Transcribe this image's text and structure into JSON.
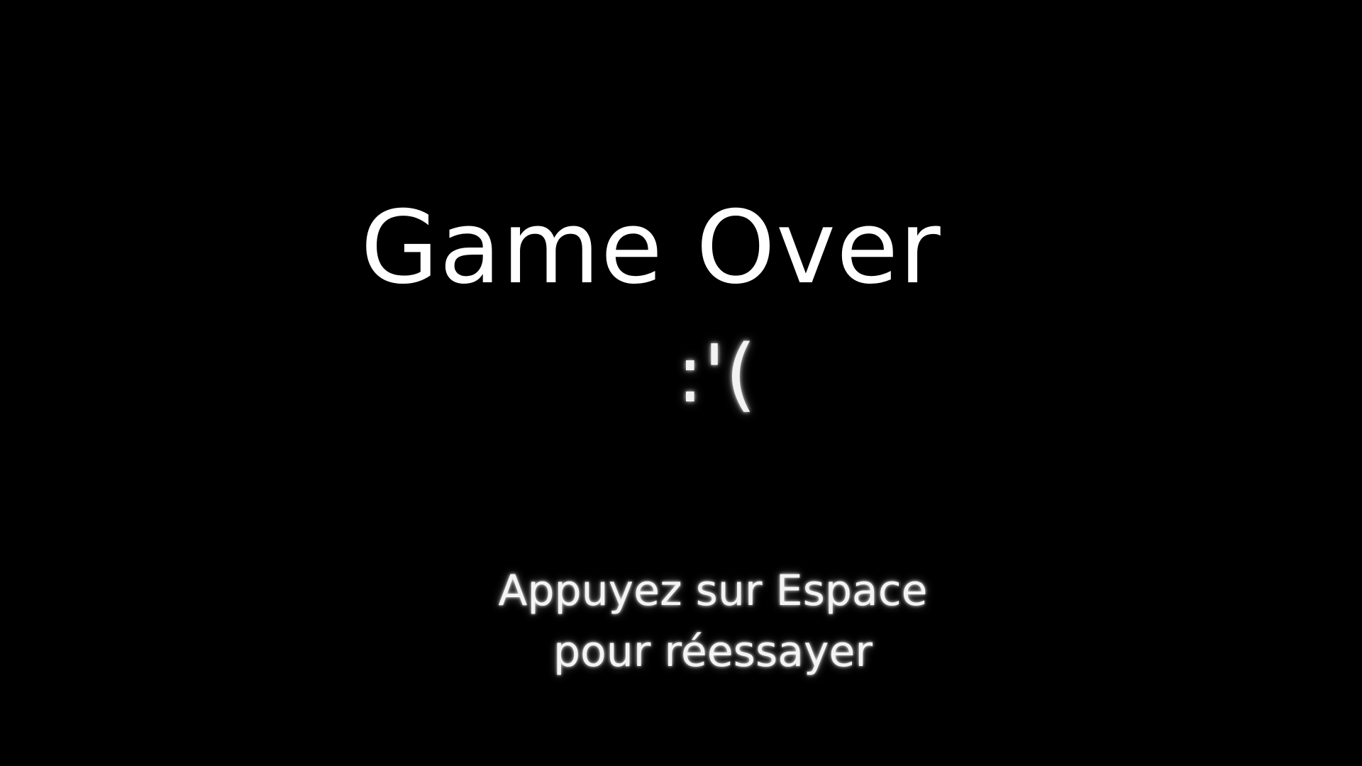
{
  "screen": {
    "title": "Game Over",
    "face": ":'(",
    "prompt_line1": "Appuyez sur Espace",
    "prompt_line2": "pour réessayer"
  }
}
